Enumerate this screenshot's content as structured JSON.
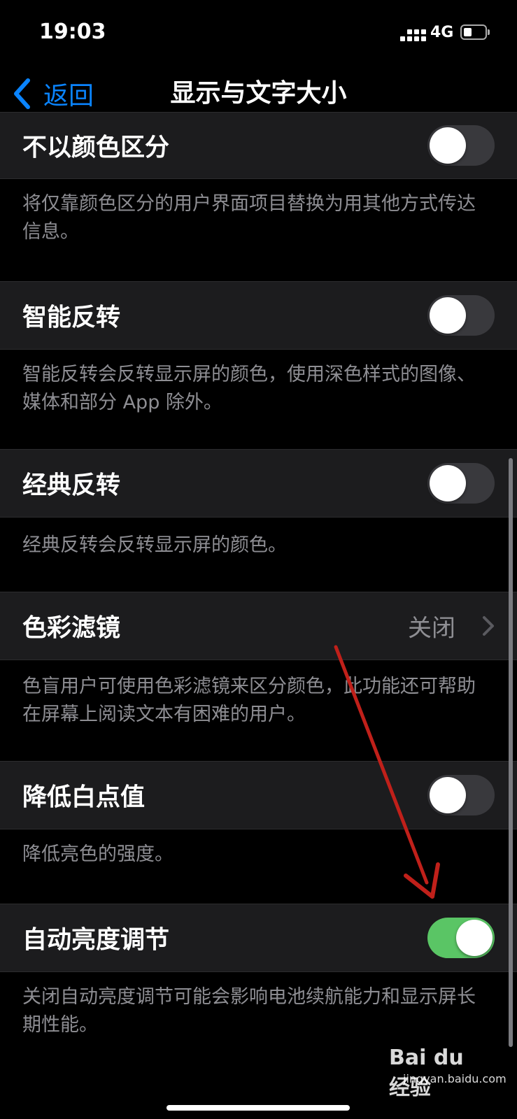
{
  "status": {
    "time": "19:03",
    "network": "4G"
  },
  "nav": {
    "back_label": "返回",
    "title": "显示与文字大小"
  },
  "cells": [
    {
      "label": "不以颜色区分",
      "toggle_on": false,
      "footer": "将仅靠颜色区分的用户界面项目替换为用其他方式传达信息。"
    },
    {
      "label": "智能反转",
      "toggle_on": false,
      "footer": "智能反转会反转显示屏的颜色，使用深色样式的图像、媒体和部分 App 除外。"
    },
    {
      "label": "经典反转",
      "toggle_on": false,
      "footer": "经典反转会反转显示屏的颜色。"
    },
    {
      "label": "色彩滤镜",
      "value": "关闭",
      "footer": "色盲用户可使用色彩滤镜来区分颜色，此功能还可帮助在屏幕上阅读文本有困难的用户。"
    },
    {
      "label": "降低白点值",
      "toggle_on": false,
      "footer": "降低亮色的强度。"
    },
    {
      "label": "自动亮度调节",
      "toggle_on": true,
      "footer": "关闭自动亮度调节可能会影响电池续航能力和显示屏长期性能。"
    }
  ],
  "colors": {
    "accent": "#0a84ff",
    "toggle_on": "#5ac565",
    "annotation_arrow": "#c0201a"
  },
  "watermark": {
    "logo": "Bai du 经验",
    "url": "jingyan.baidu.com"
  }
}
